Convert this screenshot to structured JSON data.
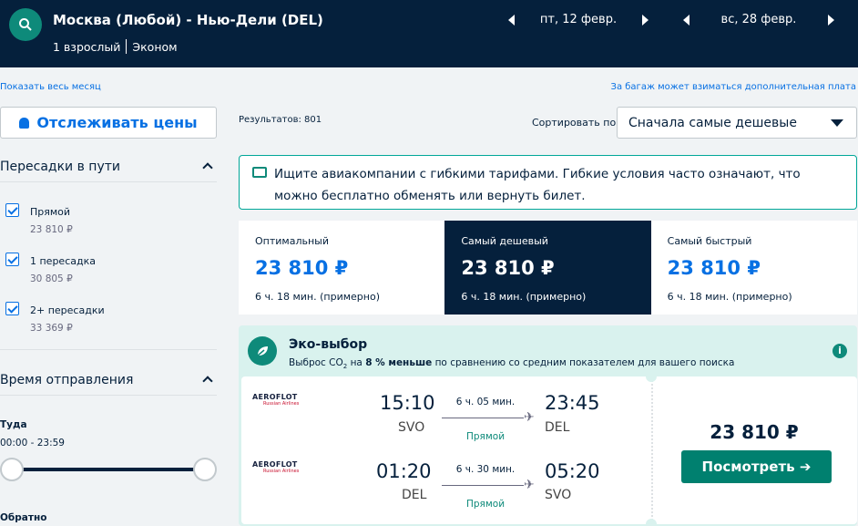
{
  "header": {
    "route": "Москва (Любой) - Нью-Дели (DEL)",
    "passengers": "1 взрослый",
    "cabin": "Эконом",
    "depart_date": "пт, 12 февр.",
    "return_date": "вс, 28 февр."
  },
  "links": {
    "show_month": "Показать весь месяц",
    "baggage_fee": "За багаж может взиматься дополнительная плата"
  },
  "track_prices": {
    "label": "Отслеживать цены",
    "icon": "bell-icon"
  },
  "filters": {
    "stops_title": "Пересадки в пути",
    "stops": [
      {
        "label": "Прямой",
        "price": "23 810 ₽",
        "checked": true
      },
      {
        "label": "1 пересадка",
        "price": "30 805 ₽",
        "checked": true
      },
      {
        "label": "2+ пересадки",
        "price": "33 369 ₽",
        "checked": true
      }
    ],
    "departure_title": "Время отправления",
    "outbound_label": "Туда",
    "outbound_range": "00:00 - 23:59",
    "return_label": "Обратно"
  },
  "results": {
    "count": "Результатов: 801",
    "sort_label": "Сортировать по",
    "sort_value": "Сначала самые дешевые"
  },
  "banner": {
    "text": "Ищите авиакомпании с гибкими тарифами. Гибкие условия часто означают, что можно бесплатно обменять или вернуть билет."
  },
  "sort_tabs": [
    {
      "title": "Оптимальный",
      "price": "23 810 ₽",
      "duration": "6 ч. 18 мин. (примерно)",
      "active": false
    },
    {
      "title": "Самый дешевый",
      "price": "23 810 ₽",
      "duration": "6 ч. 18 мин. (примерно)",
      "active": true
    },
    {
      "title": "Самый быстрый",
      "price": "23 810 ₽",
      "duration": "6 ч. 18 мин. (примерно)",
      "active": false
    }
  ],
  "eco": {
    "title": "Эко-выбор",
    "subtitle_pre": "Выброс CO",
    "subtitle_sub": "2",
    "subtitle_mid": " на ",
    "subtitle_bold": "8 % меньше",
    "subtitle_post": " по сравнению со средним показателем для вашего поиска"
  },
  "ticket": {
    "price": "23 810 ₽",
    "button": "Посмотреть ➔",
    "legs": [
      {
        "airline": "AEROFLOT",
        "airline_sub": "Russian Airlines",
        "dep_time": "15:10",
        "dep_code": "SVO",
        "duration": "6 ч. 05 мин.",
        "stops": "Прямой",
        "arr_time": "23:45",
        "arr_code": "DEL"
      },
      {
        "airline": "AEROFLOT",
        "airline_sub": "Russian Airlines",
        "dep_time": "01:20",
        "dep_code": "DEL",
        "duration": "6 ч. 30 мин.",
        "stops": "Прямой",
        "arr_time": "05:20",
        "arr_code": "SVO"
      }
    ]
  },
  "colors": {
    "header_bg": "#05203c",
    "accent_blue": "#0770e3",
    "eco_green": "#0e8a7a",
    "button_green": "#00806f"
  }
}
